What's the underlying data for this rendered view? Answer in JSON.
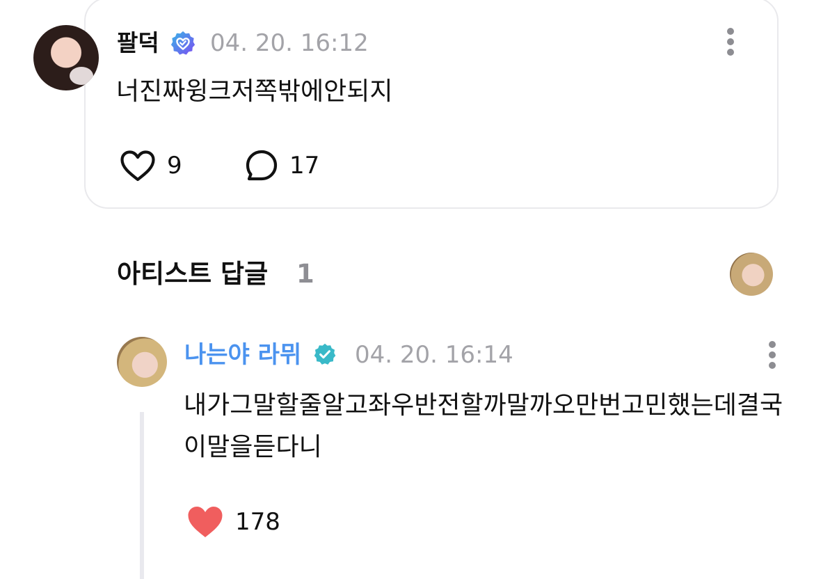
{
  "post": {
    "author": "팔덕",
    "timestamp": "04. 20. 16:12",
    "text": "너진짜윙크저쪽밖에안되지",
    "like_count": "9",
    "comment_count": "17"
  },
  "artist_replies": {
    "title": "아티스트 답글",
    "count": "1"
  },
  "reply": {
    "author": "나는야 라뮈",
    "timestamp": "04. 20. 16:14",
    "text": "내가그말할줄알고좌우반전할까말까오만번고민했는데결국이말을듣다니",
    "like_count": "178"
  },
  "icons": {
    "post_badge": "verified-heart-badge-icon",
    "reply_badge": "verified-check-badge-icon",
    "more": "more-vertical-icon",
    "like": "heart-outline-icon",
    "liked": "heart-filled-icon",
    "comment": "comment-bubble-icon"
  },
  "colors": {
    "artist_name": "#4b93ef",
    "timestamp": "#a3a3a8",
    "liked_heart": "#f05e5e",
    "verified_badge": "#6b5cf0",
    "artist_badge": "#39b9c8",
    "card_border": "#e9e9ec"
  }
}
